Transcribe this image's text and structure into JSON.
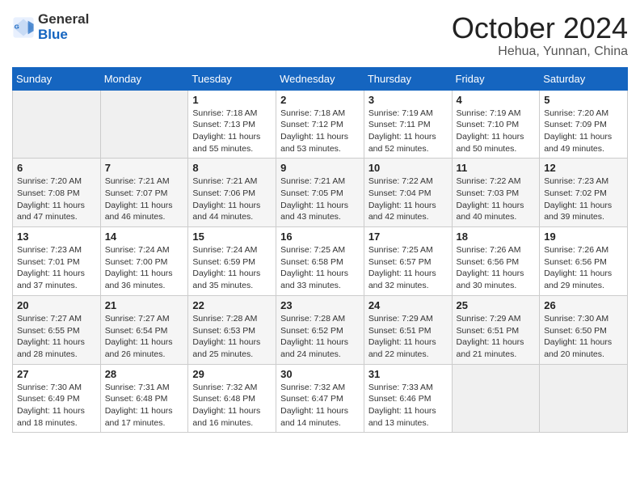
{
  "header": {
    "logo_line1": "General",
    "logo_line2": "Blue",
    "month": "October 2024",
    "location": "Hehua, Yunnan, China"
  },
  "weekdays": [
    "Sunday",
    "Monday",
    "Tuesday",
    "Wednesday",
    "Thursday",
    "Friday",
    "Saturday"
  ],
  "weeks": [
    [
      {
        "day": "",
        "info": ""
      },
      {
        "day": "",
        "info": ""
      },
      {
        "day": "1",
        "info": "Sunrise: 7:18 AM\nSunset: 7:13 PM\nDaylight: 11 hours and 55 minutes."
      },
      {
        "day": "2",
        "info": "Sunrise: 7:18 AM\nSunset: 7:12 PM\nDaylight: 11 hours and 53 minutes."
      },
      {
        "day": "3",
        "info": "Sunrise: 7:19 AM\nSunset: 7:11 PM\nDaylight: 11 hours and 52 minutes."
      },
      {
        "day": "4",
        "info": "Sunrise: 7:19 AM\nSunset: 7:10 PM\nDaylight: 11 hours and 50 minutes."
      },
      {
        "day": "5",
        "info": "Sunrise: 7:20 AM\nSunset: 7:09 PM\nDaylight: 11 hours and 49 minutes."
      }
    ],
    [
      {
        "day": "6",
        "info": "Sunrise: 7:20 AM\nSunset: 7:08 PM\nDaylight: 11 hours and 47 minutes."
      },
      {
        "day": "7",
        "info": "Sunrise: 7:21 AM\nSunset: 7:07 PM\nDaylight: 11 hours and 46 minutes."
      },
      {
        "day": "8",
        "info": "Sunrise: 7:21 AM\nSunset: 7:06 PM\nDaylight: 11 hours and 44 minutes."
      },
      {
        "day": "9",
        "info": "Sunrise: 7:21 AM\nSunset: 7:05 PM\nDaylight: 11 hours and 43 minutes."
      },
      {
        "day": "10",
        "info": "Sunrise: 7:22 AM\nSunset: 7:04 PM\nDaylight: 11 hours and 42 minutes."
      },
      {
        "day": "11",
        "info": "Sunrise: 7:22 AM\nSunset: 7:03 PM\nDaylight: 11 hours and 40 minutes."
      },
      {
        "day": "12",
        "info": "Sunrise: 7:23 AM\nSunset: 7:02 PM\nDaylight: 11 hours and 39 minutes."
      }
    ],
    [
      {
        "day": "13",
        "info": "Sunrise: 7:23 AM\nSunset: 7:01 PM\nDaylight: 11 hours and 37 minutes."
      },
      {
        "day": "14",
        "info": "Sunrise: 7:24 AM\nSunset: 7:00 PM\nDaylight: 11 hours and 36 minutes."
      },
      {
        "day": "15",
        "info": "Sunrise: 7:24 AM\nSunset: 6:59 PM\nDaylight: 11 hours and 35 minutes."
      },
      {
        "day": "16",
        "info": "Sunrise: 7:25 AM\nSunset: 6:58 PM\nDaylight: 11 hours and 33 minutes."
      },
      {
        "day": "17",
        "info": "Sunrise: 7:25 AM\nSunset: 6:57 PM\nDaylight: 11 hours and 32 minutes."
      },
      {
        "day": "18",
        "info": "Sunrise: 7:26 AM\nSunset: 6:56 PM\nDaylight: 11 hours and 30 minutes."
      },
      {
        "day": "19",
        "info": "Sunrise: 7:26 AM\nSunset: 6:56 PM\nDaylight: 11 hours and 29 minutes."
      }
    ],
    [
      {
        "day": "20",
        "info": "Sunrise: 7:27 AM\nSunset: 6:55 PM\nDaylight: 11 hours and 28 minutes."
      },
      {
        "day": "21",
        "info": "Sunrise: 7:27 AM\nSunset: 6:54 PM\nDaylight: 11 hours and 26 minutes."
      },
      {
        "day": "22",
        "info": "Sunrise: 7:28 AM\nSunset: 6:53 PM\nDaylight: 11 hours and 25 minutes."
      },
      {
        "day": "23",
        "info": "Sunrise: 7:28 AM\nSunset: 6:52 PM\nDaylight: 11 hours and 24 minutes."
      },
      {
        "day": "24",
        "info": "Sunrise: 7:29 AM\nSunset: 6:51 PM\nDaylight: 11 hours and 22 minutes."
      },
      {
        "day": "25",
        "info": "Sunrise: 7:29 AM\nSunset: 6:51 PM\nDaylight: 11 hours and 21 minutes."
      },
      {
        "day": "26",
        "info": "Sunrise: 7:30 AM\nSunset: 6:50 PM\nDaylight: 11 hours and 20 minutes."
      }
    ],
    [
      {
        "day": "27",
        "info": "Sunrise: 7:30 AM\nSunset: 6:49 PM\nDaylight: 11 hours and 18 minutes."
      },
      {
        "day": "28",
        "info": "Sunrise: 7:31 AM\nSunset: 6:48 PM\nDaylight: 11 hours and 17 minutes."
      },
      {
        "day": "29",
        "info": "Sunrise: 7:32 AM\nSunset: 6:48 PM\nDaylight: 11 hours and 16 minutes."
      },
      {
        "day": "30",
        "info": "Sunrise: 7:32 AM\nSunset: 6:47 PM\nDaylight: 11 hours and 14 minutes."
      },
      {
        "day": "31",
        "info": "Sunrise: 7:33 AM\nSunset: 6:46 PM\nDaylight: 11 hours and 13 minutes."
      },
      {
        "day": "",
        "info": ""
      },
      {
        "day": "",
        "info": ""
      }
    ]
  ]
}
